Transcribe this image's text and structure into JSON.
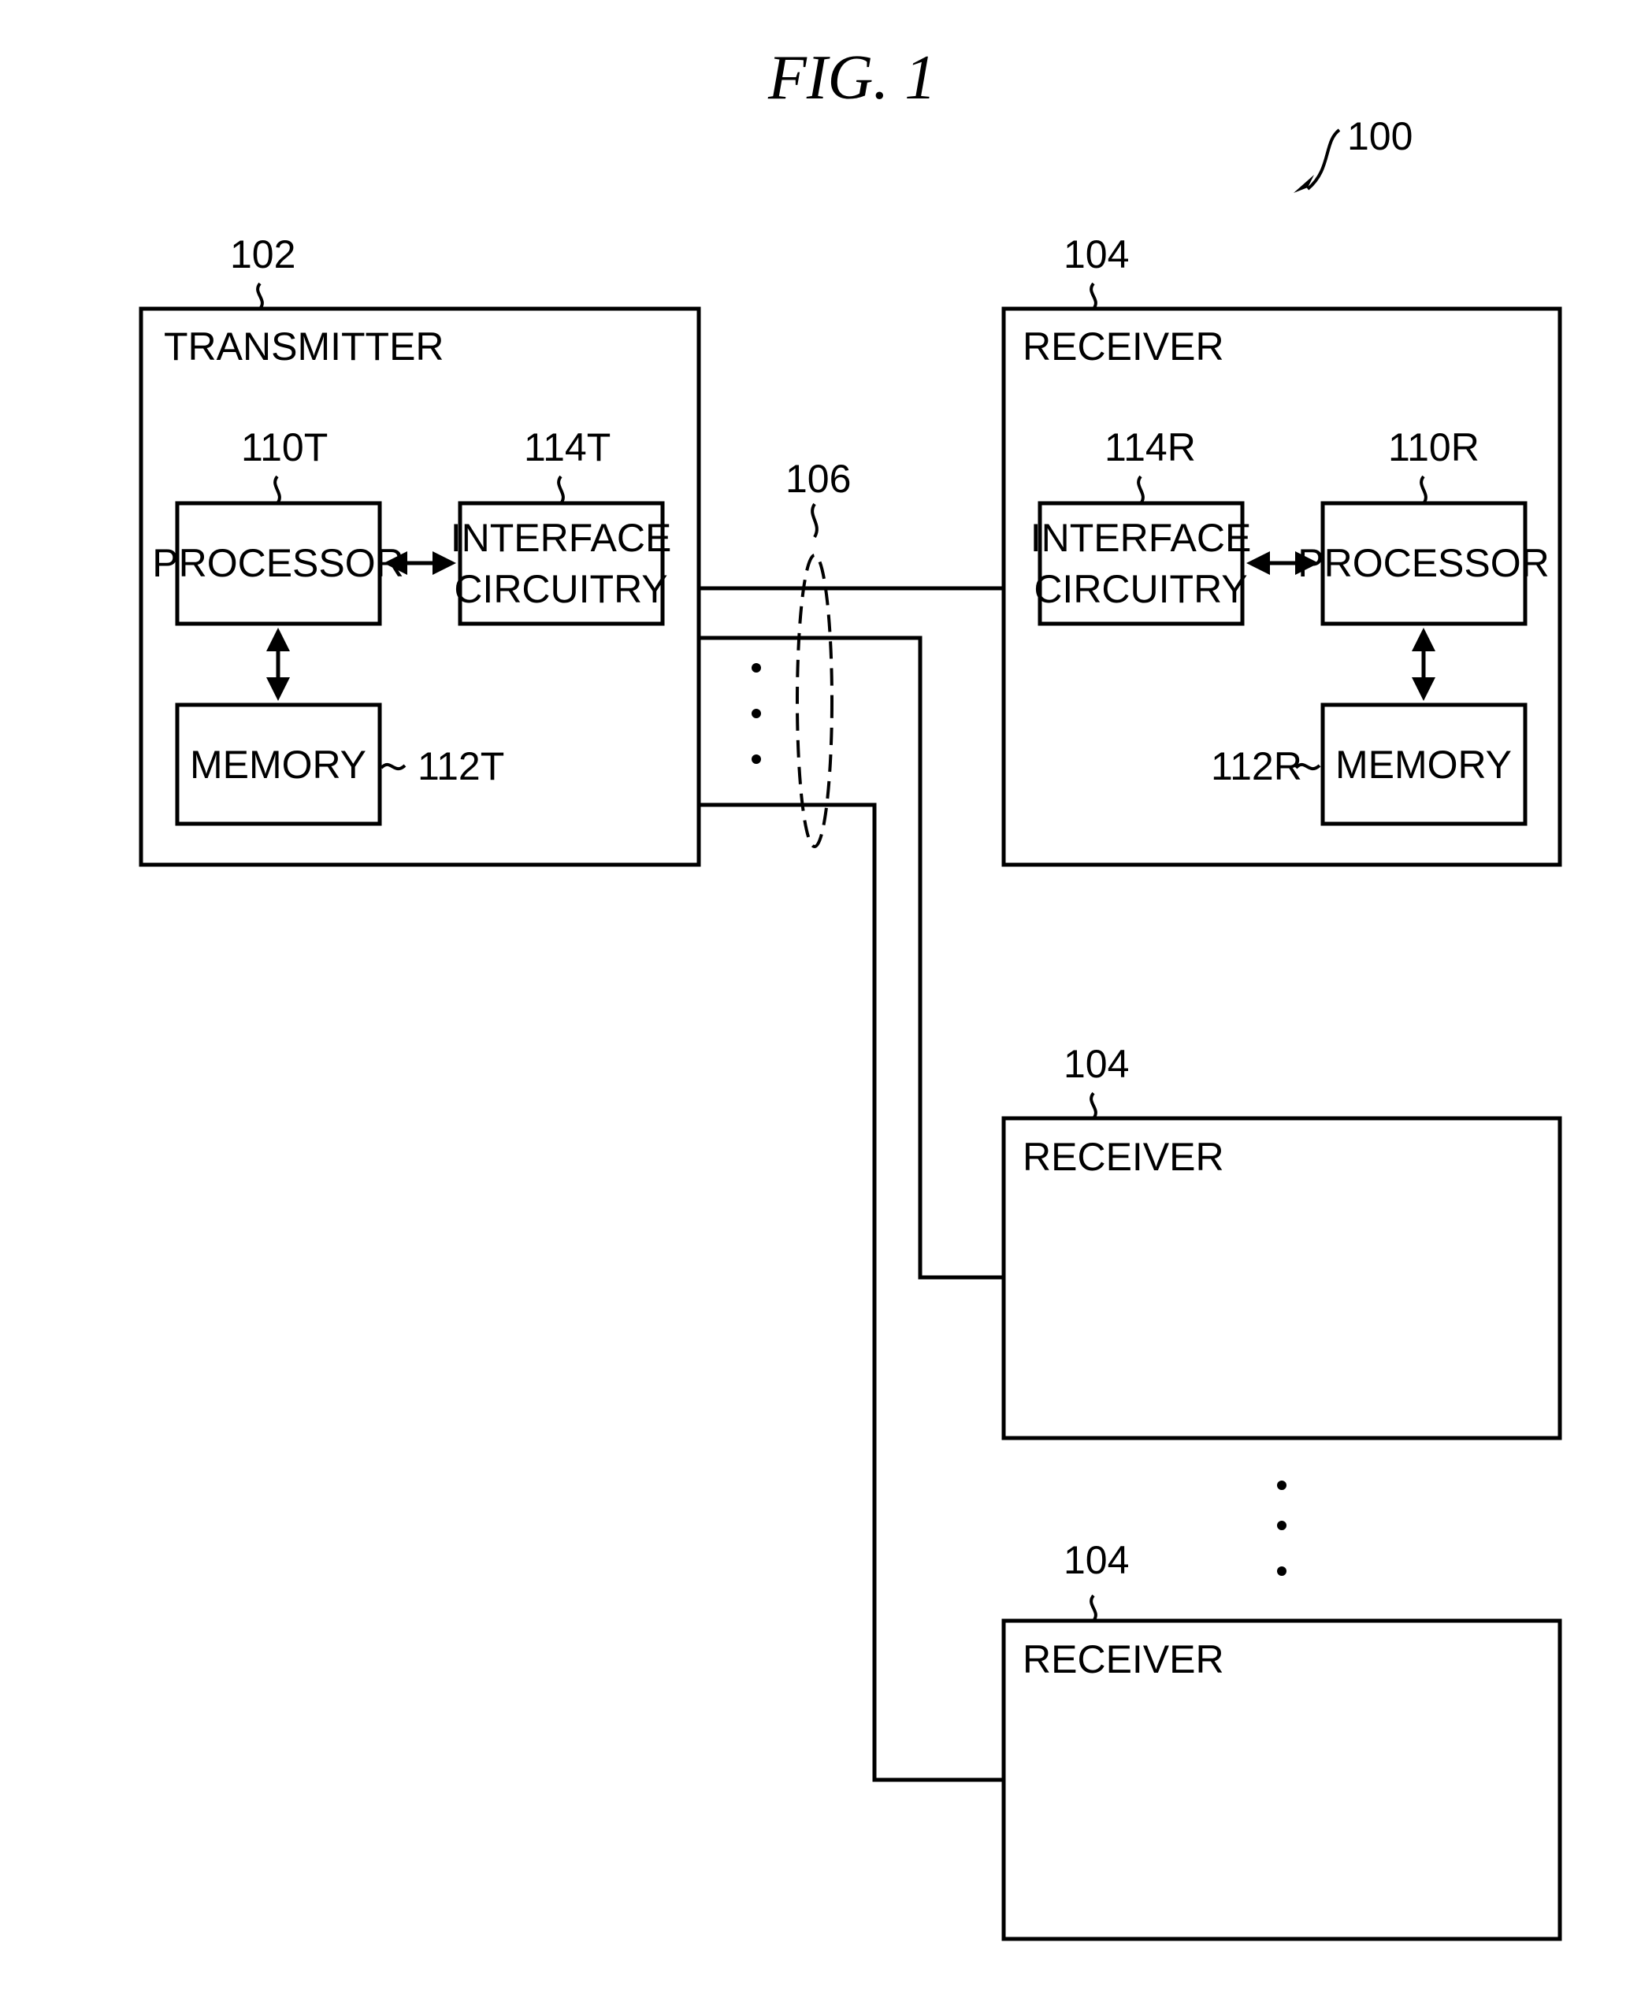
{
  "figure": {
    "title": "FIG.  1",
    "system_ref": "100"
  },
  "transmitter": {
    "ref": "102",
    "label": "TRANSMITTER",
    "processor": {
      "ref": "110T",
      "label": "PROCESSOR"
    },
    "interface": {
      "ref": "114T",
      "label_line1": "INTERFACE",
      "label_line2": "CIRCUITRY"
    },
    "memory": {
      "ref": "112T",
      "label": "MEMORY"
    }
  },
  "channel": {
    "ref": "106"
  },
  "receivers": [
    {
      "ref": "104",
      "label": "RECEIVER",
      "interface": {
        "ref": "114R",
        "label_line1": "INTERFACE",
        "label_line2": "CIRCUITRY"
      },
      "processor": {
        "ref": "110R",
        "label": "PROCESSOR"
      },
      "memory": {
        "ref": "112R",
        "label": "MEMORY"
      }
    },
    {
      "ref": "104",
      "label": "RECEIVER"
    },
    {
      "ref": "104",
      "label": "RECEIVER"
    }
  ]
}
